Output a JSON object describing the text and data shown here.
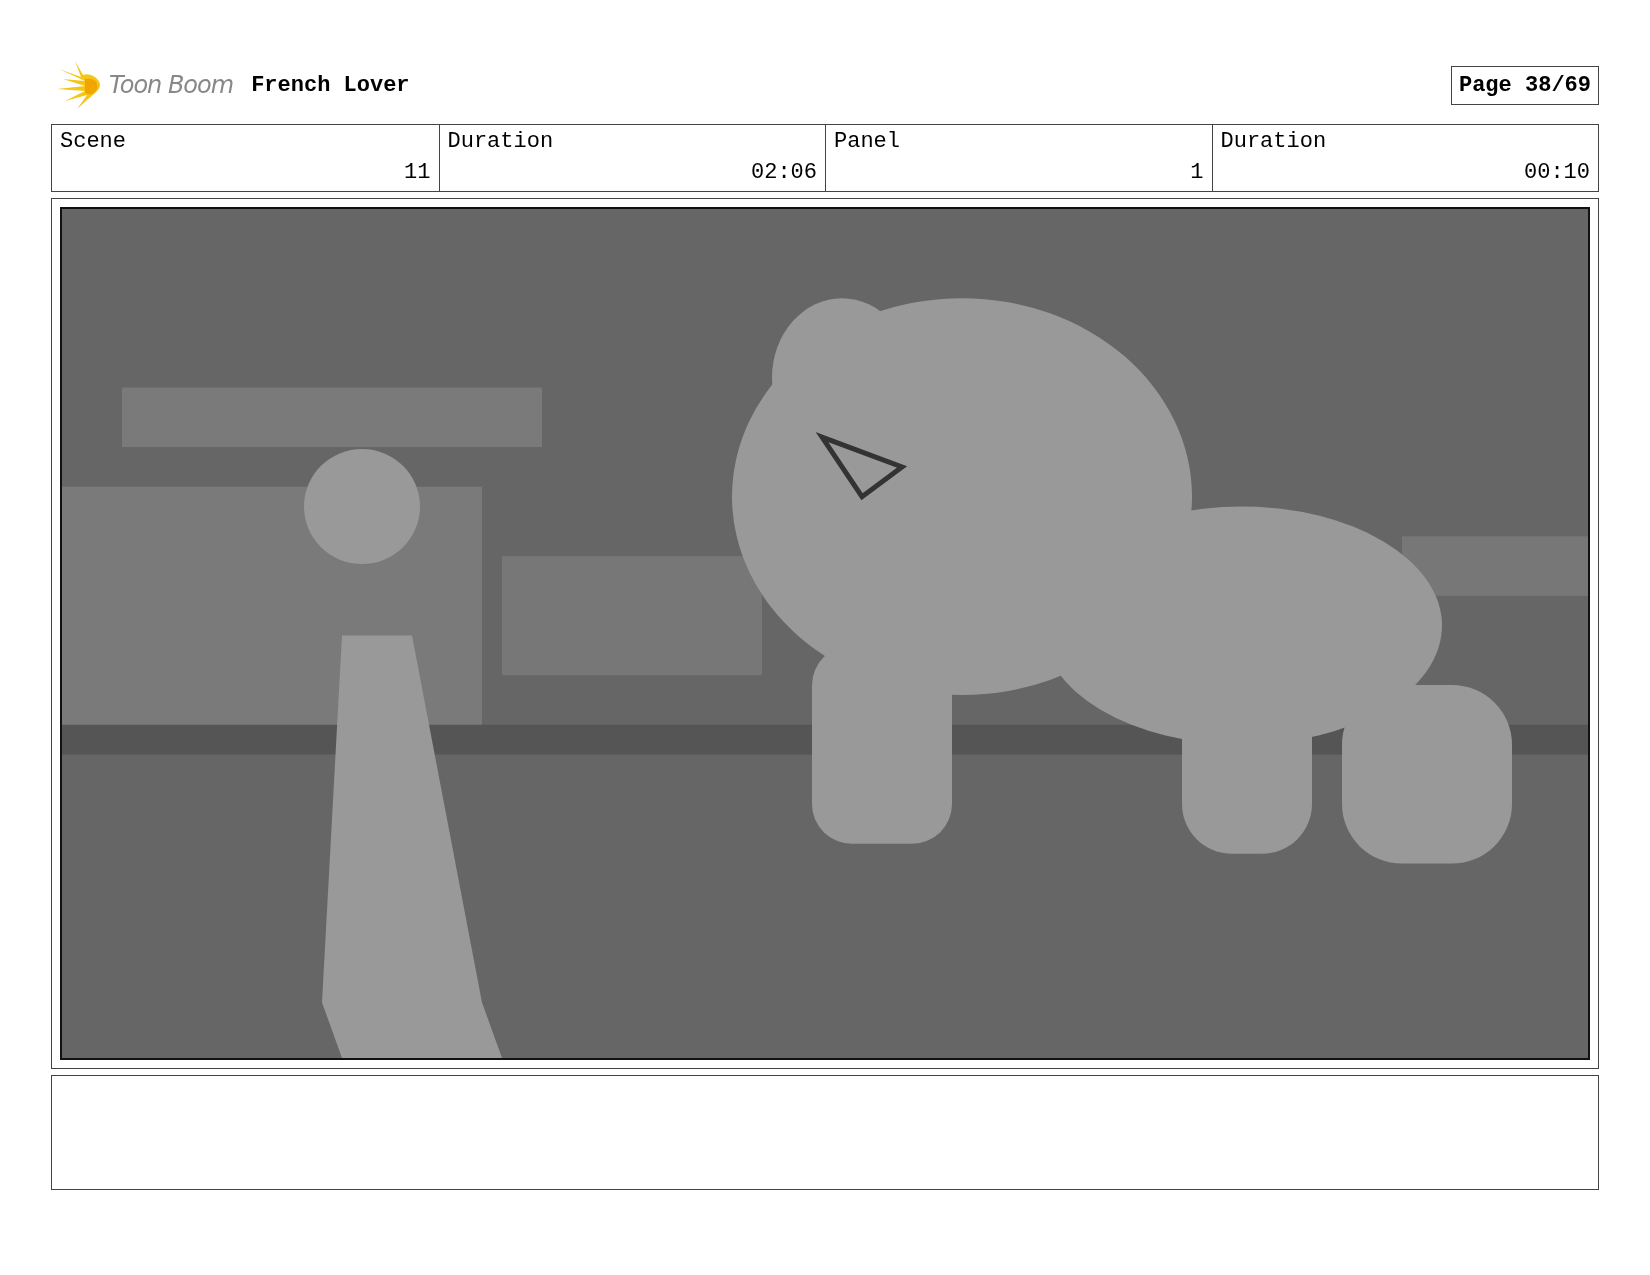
{
  "header": {
    "logo_text": "Toon Boom",
    "title": "French Lover",
    "page": "Page 38/69"
  },
  "info_table": {
    "columns": [
      "Scene",
      "Duration",
      "Panel",
      "Duration"
    ],
    "rows": [
      [
        "11",
        "02:06",
        "1",
        "00:10"
      ]
    ]
  }
}
